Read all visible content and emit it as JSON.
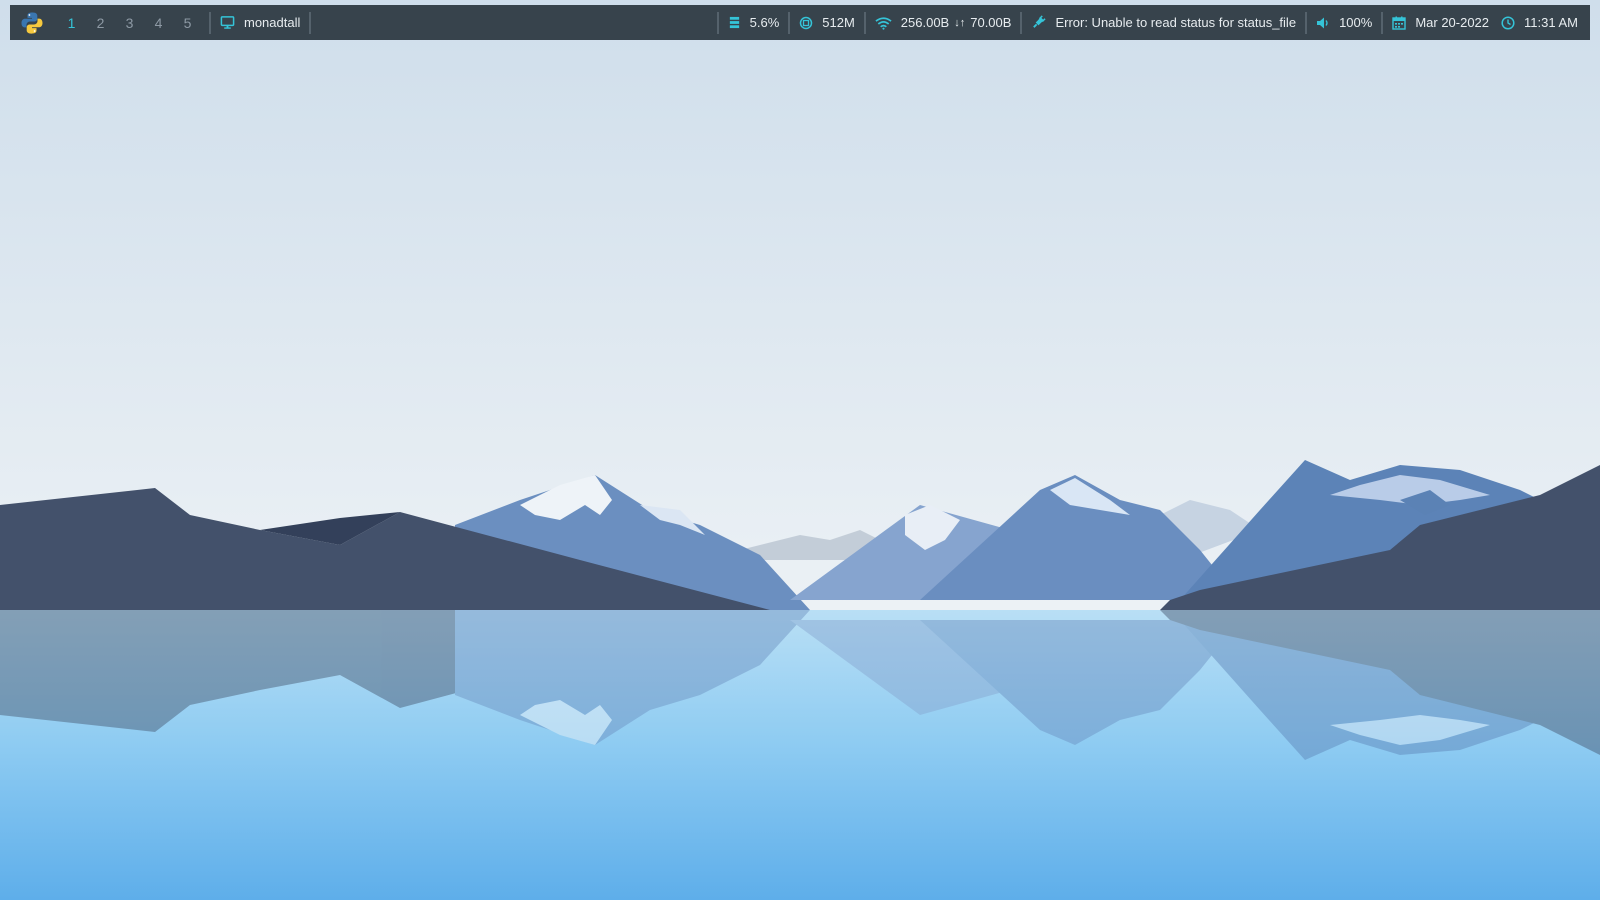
{
  "colors": {
    "bar_bg": "#37434c",
    "accent": "#35c4d8",
    "text": "#e7ecef",
    "inactive_workspace": "#8d99a4"
  },
  "bar": {
    "logo_icon": "python-logo-icon",
    "workspaces": [
      {
        "label": "1",
        "active": true
      },
      {
        "label": "2",
        "active": false
      },
      {
        "label": "3",
        "active": false
      },
      {
        "label": "4",
        "active": false
      },
      {
        "label": "5",
        "active": false
      }
    ],
    "layout": {
      "icon": "monitor-icon",
      "name": "monadtall"
    },
    "widgets": {
      "cpu": {
        "icon": "cpu-chip-icon",
        "value": "5.6%"
      },
      "memory": {
        "icon": "memory-icon",
        "value": "512M"
      },
      "network": {
        "icon": "wifi-icon",
        "down": "256.00B",
        "arrows": "↓↑",
        "up": "70.00B"
      },
      "battery": {
        "icon": "plug-icon",
        "value": "Error: Unable to read status for status_file"
      },
      "volume": {
        "icon": "speaker-icon",
        "value": "100%"
      },
      "date": {
        "icon": "calendar-icon",
        "value": "Mar 20-2022"
      },
      "clock": {
        "icon": "clock-icon",
        "value": "11:31 AM"
      }
    }
  }
}
